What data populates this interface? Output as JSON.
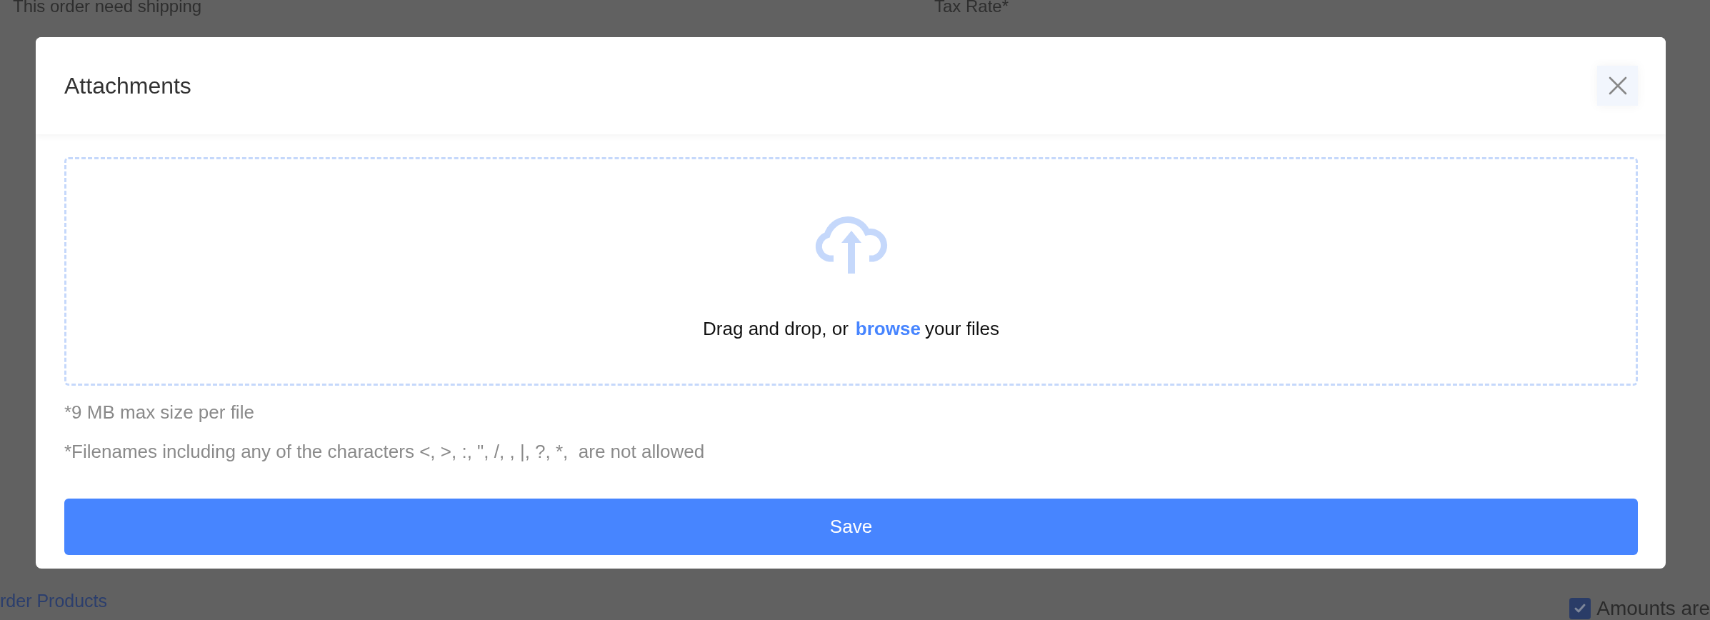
{
  "background": {
    "shipping_label": "This order need shipping",
    "tax_rate_label": "Tax Rate*",
    "order_products_link": "rder Products",
    "amounts_checkbox": {
      "label": "Amounts are",
      "checked": true
    }
  },
  "modal": {
    "title": "Attachments",
    "dropzone": {
      "prefix": "Drag and drop, or",
      "link": "browse",
      "suffix": "your files"
    },
    "notes": [
      "*9 MB max size per file",
      "*Filenames including any of the characters <, >, :, \", /, , |, ?, *,  are not allowed"
    ],
    "save_button": "Save"
  }
}
